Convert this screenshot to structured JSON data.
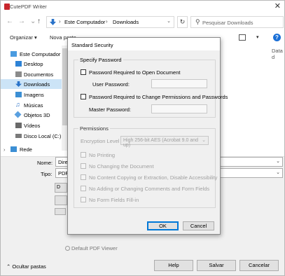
{
  "window": {
    "title": "CutePDF Writer",
    "close_glyph": "✕"
  },
  "addressbar": {
    "back": "←",
    "forward": "→",
    "up": "↑",
    "crumbs": [
      "Este Computador",
      "Downloads"
    ],
    "refresh": "↻",
    "search_placeholder": "Pesquisar Downloads"
  },
  "toolbar": {
    "organize": "Organizar ▾",
    "new_folder": "Nova pasta"
  },
  "sidebar": {
    "items": [
      {
        "label": "Este Computador",
        "icon": "computer-icon",
        "color": "#4a9be0"
      },
      {
        "label": "Desktop",
        "icon": "desktop-icon",
        "color": "#2d82d6"
      },
      {
        "label": "Documentos",
        "icon": "documents-icon",
        "color": "#8b8b8b"
      },
      {
        "label": "Downloads",
        "icon": "downloads-icon",
        "color": "#2a73c9"
      },
      {
        "label": "Imagens",
        "icon": "pictures-icon",
        "color": "#3c8fd4"
      },
      {
        "label": "Músicas",
        "icon": "music-icon",
        "color": "#2a73c9"
      },
      {
        "label": "Objetos 3D",
        "icon": "3d-objects-icon",
        "color": "#5aa0e0"
      },
      {
        "label": "Vídeos",
        "icon": "videos-icon",
        "color": "#6a6a6a"
      },
      {
        "label": "Disco Local (C:)",
        "icon": "drive-icon",
        "color": "#7a7a7a"
      },
      {
        "label": "Rede",
        "icon": "network-icon",
        "color": "#3c8fd4"
      }
    ]
  },
  "filelist": {
    "date_header": "Data d"
  },
  "form": {
    "name_label": "Nome:",
    "name_value": "Dire",
    "type_label": "Tipo:",
    "type_value": "PDF",
    "option_buttons": [
      "D",
      "",
      ""
    ],
    "pdf_viewer": "Default PDF Viewer",
    "hide_folders": "Ocultar pastas"
  },
  "buttons": {
    "help": "Help",
    "save": "Salvar",
    "cancel": "Cancelar"
  },
  "dialog": {
    "title": "Standard Security",
    "password_group": "Specify Password",
    "open_pw_check": "Password Required to Open Document",
    "user_pw_label": "User Password:",
    "perm_pw_check": "Password Required to Change Permissions and Passwords",
    "master_pw_label": "Master Password:",
    "permissions_group": "Permissions",
    "encryption_label": "Encryption Level",
    "encryption_value": "High 256-bit AES (Acrobat 9.0 and up)",
    "permissions": [
      "No Printing",
      "No Changing the Document",
      "No Content Copying or Extraction, Disable Accessibility",
      "No Adding or Changing Comments and Form Fields",
      "No Form Fields Fill-in"
    ],
    "ok": "OK",
    "cancel": "Cancel"
  }
}
